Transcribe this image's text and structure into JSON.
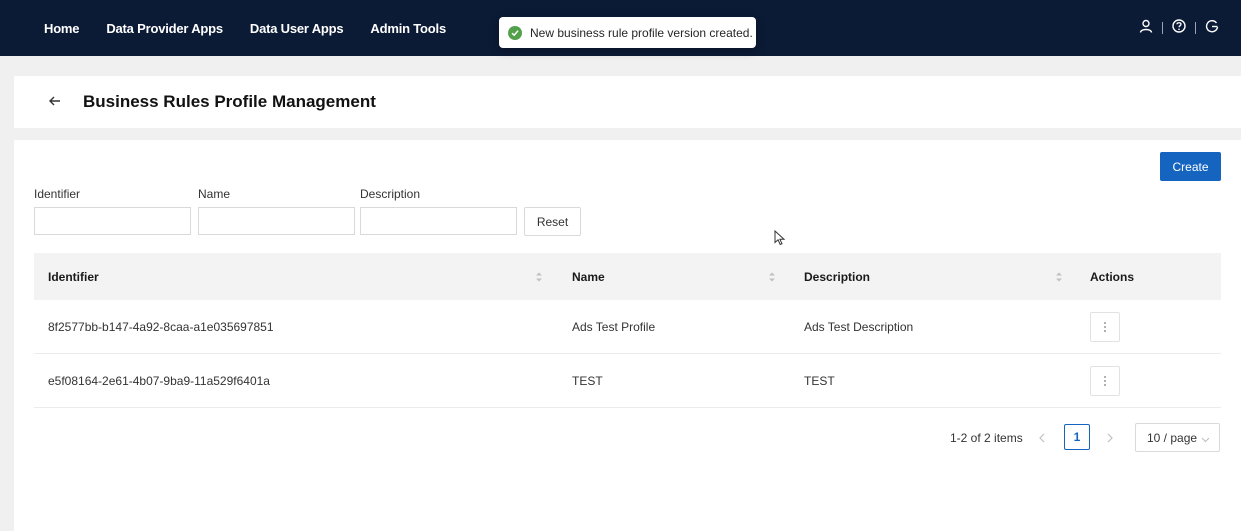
{
  "nav": {
    "items": [
      "Home",
      "Data Provider Apps",
      "Data User Apps",
      "Admin Tools"
    ]
  },
  "top_icons": [
    "user-icon",
    "help-icon",
    "logout-icon"
  ],
  "toast": {
    "message": "New business rule profile version created.",
    "status": "success",
    "icon": "check-circle-icon"
  },
  "header": {
    "title": "Business Rules Profile Management",
    "back_icon": "arrow-left-icon"
  },
  "toolbar": {
    "create_label": "Create"
  },
  "filters": {
    "identifier_label": "Identifier",
    "identifier_value": "",
    "name_label": "Name",
    "name_value": "",
    "description_label": "Description",
    "description_value": "",
    "reset_label": "Reset"
  },
  "table": {
    "columns": [
      "Identifier",
      "Name",
      "Description",
      "Actions"
    ],
    "rows": [
      {
        "identifier": "8f2577bb-b147-4a92-8caa-a1e035697851",
        "name": "Ads Test Profile",
        "description": "Ads Test Description",
        "action_icon": "more-vertical-icon"
      },
      {
        "identifier": "e5f08164-2e61-4b07-9ba9-11a529f6401a",
        "name": "TEST",
        "description": "TEST",
        "action_icon": "more-vertical-icon"
      }
    ]
  },
  "pagination": {
    "summary": "1-2 of 2 items",
    "current_page": "1",
    "page_size": "10 / page"
  },
  "colors": {
    "topbar": "#0b1a35",
    "primary": "#1565c0",
    "success": "#52a04a",
    "page_bg": "#f0f0f0"
  }
}
